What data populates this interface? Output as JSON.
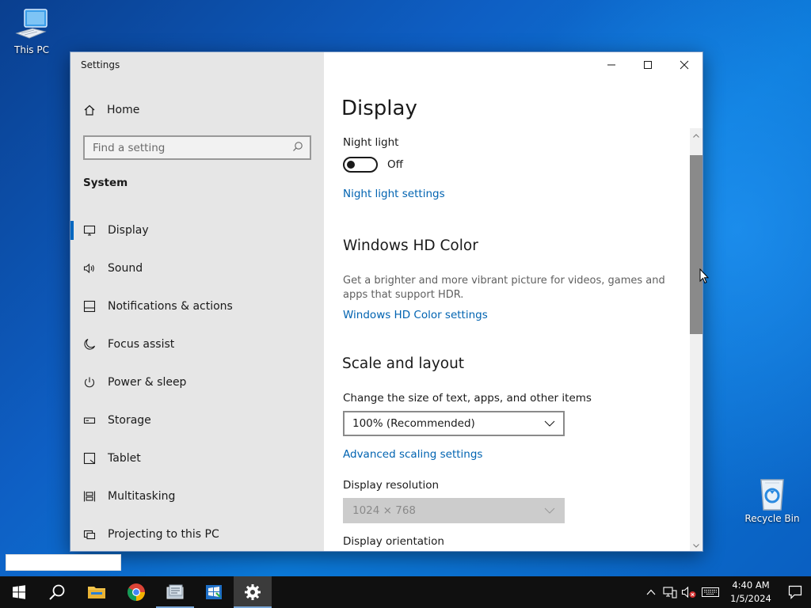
{
  "desktop": {
    "icons": [
      {
        "label": "This PC"
      },
      {
        "label": "Recycle Bin"
      }
    ]
  },
  "window": {
    "app_title": "Settings",
    "controls": {
      "minimize": "minimize-icon",
      "maximize": "maximize-icon",
      "close": "close-icon"
    }
  },
  "sidebar": {
    "home_label": "Home",
    "search_placeholder": "Find a setting",
    "section": "System",
    "items": [
      {
        "label": "Display",
        "icon": "monitor-icon",
        "active": true
      },
      {
        "label": "Sound",
        "icon": "speaker-icon"
      },
      {
        "label": "Notifications & actions",
        "icon": "notification-icon"
      },
      {
        "label": "Focus assist",
        "icon": "moon-icon"
      },
      {
        "label": "Power & sleep",
        "icon": "power-icon"
      },
      {
        "label": "Storage",
        "icon": "storage-icon"
      },
      {
        "label": "Tablet",
        "icon": "tablet-icon"
      },
      {
        "label": "Multitasking",
        "icon": "multitasking-icon"
      },
      {
        "label": "Projecting to this PC",
        "icon": "projector-icon"
      }
    ]
  },
  "content": {
    "title": "Display",
    "night_light": {
      "label": "Night light",
      "state": "Off",
      "link": "Night light settings"
    },
    "hd_color": {
      "heading": "Windows HD Color",
      "description": "Get a brighter and more vibrant picture for videos, games and apps that support HDR.",
      "link": "Windows HD Color settings"
    },
    "scale_layout": {
      "heading": "Scale and layout",
      "size_label": "Change the size of text, apps, and other items",
      "size_value": "100% (Recommended)",
      "advanced_link": "Advanced scaling settings",
      "resolution_label": "Display resolution",
      "resolution_value": "1024 × 768",
      "orientation_label": "Display orientation"
    }
  },
  "taskbar": {
    "apps": [
      "start-icon",
      "search-icon",
      "file-explorer-icon",
      "chrome-icon",
      "app-icon",
      "app-icon-2",
      "settings-icon"
    ],
    "tray": {
      "time": "4:40 AM",
      "date": "1/5/2024"
    }
  },
  "colors": {
    "accent": "#0067c0",
    "link": "#0063b1",
    "sidebar_bg": "#e6e6e6",
    "taskbar_bg": "#101010"
  }
}
